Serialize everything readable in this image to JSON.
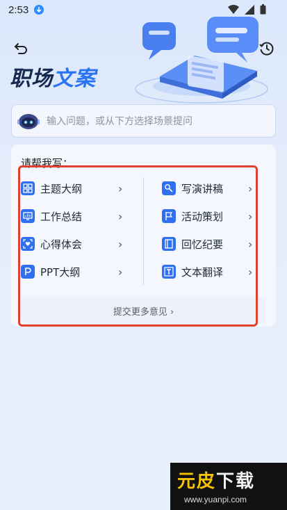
{
  "status": {
    "time": "2:53"
  },
  "header": {
    "title_part1": "职场",
    "title_part2": "文案"
  },
  "ask": {
    "placeholder": "输入问题，或从下方选择场景提问"
  },
  "card": {
    "title": "请帮我写：",
    "left_items": [
      {
        "label": "主题大纲",
        "icon": "grid-icon"
      },
      {
        "label": "工作总结",
        "icon": "monitor-chart-icon"
      },
      {
        "label": "心得体会",
        "icon": "heart-frame-icon"
      },
      {
        "label": "PPT大纲",
        "icon": "p-letter-icon"
      }
    ],
    "right_items": [
      {
        "label": "写演讲稿",
        "icon": "pen-icon"
      },
      {
        "label": "活动策划",
        "icon": "flag-icon"
      },
      {
        "label": "回忆纪要",
        "icon": "notebook-icon"
      },
      {
        "label": "文本翻译",
        "icon": "t-letter-icon"
      }
    ],
    "feedback_label": "提交更多意见 ›",
    "chevron": "›"
  },
  "watermark": {
    "logo_a": "元",
    "logo_b": "皮",
    "logo_c": "下载",
    "url": "www.yuanpi.com"
  },
  "colors": {
    "accent": "#2f6ff0",
    "highlight": "#e0402e"
  }
}
